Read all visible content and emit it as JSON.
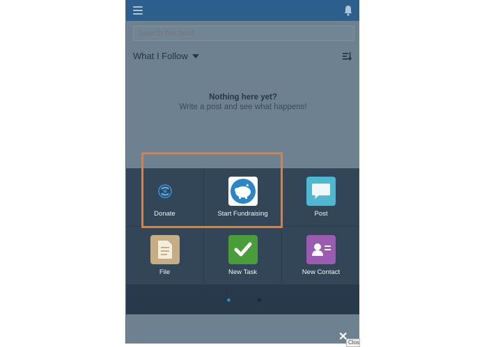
{
  "header": {
    "menu_icon": "hamburger-icon",
    "notifications_icon": "bell-icon"
  },
  "search": {
    "placeholder": "Search this feed"
  },
  "feed": {
    "filter_label": "What I Follow",
    "sort_icon": "sort-icon"
  },
  "empty_state": {
    "title": "Nothing here yet?",
    "subtitle": "Write a post and see what happens!"
  },
  "actions": [
    {
      "label": "Donate",
      "icon": "donate-icon",
      "color": "#334658"
    },
    {
      "label": "Start Fundraising",
      "icon": "piggy-bank-icon",
      "color": "#2a86c8"
    },
    {
      "label": "Post",
      "icon": "speech-bubble-icon",
      "color": "#4fb8d0"
    },
    {
      "label": "File",
      "icon": "file-icon",
      "color": "#c5ad85"
    },
    {
      "label": "New Task",
      "icon": "checkmark-icon",
      "color": "#4a9e3a"
    },
    {
      "label": "New Contact",
      "icon": "contact-card-icon",
      "color": "#9a5bb0"
    }
  ],
  "pager": {
    "pages": 2,
    "active_page": 1,
    "active_color": "#2a86c8",
    "inactive_color": "#182733"
  },
  "highlight": {
    "color": "#ef7b2a"
  },
  "close": {
    "label": "Close"
  }
}
